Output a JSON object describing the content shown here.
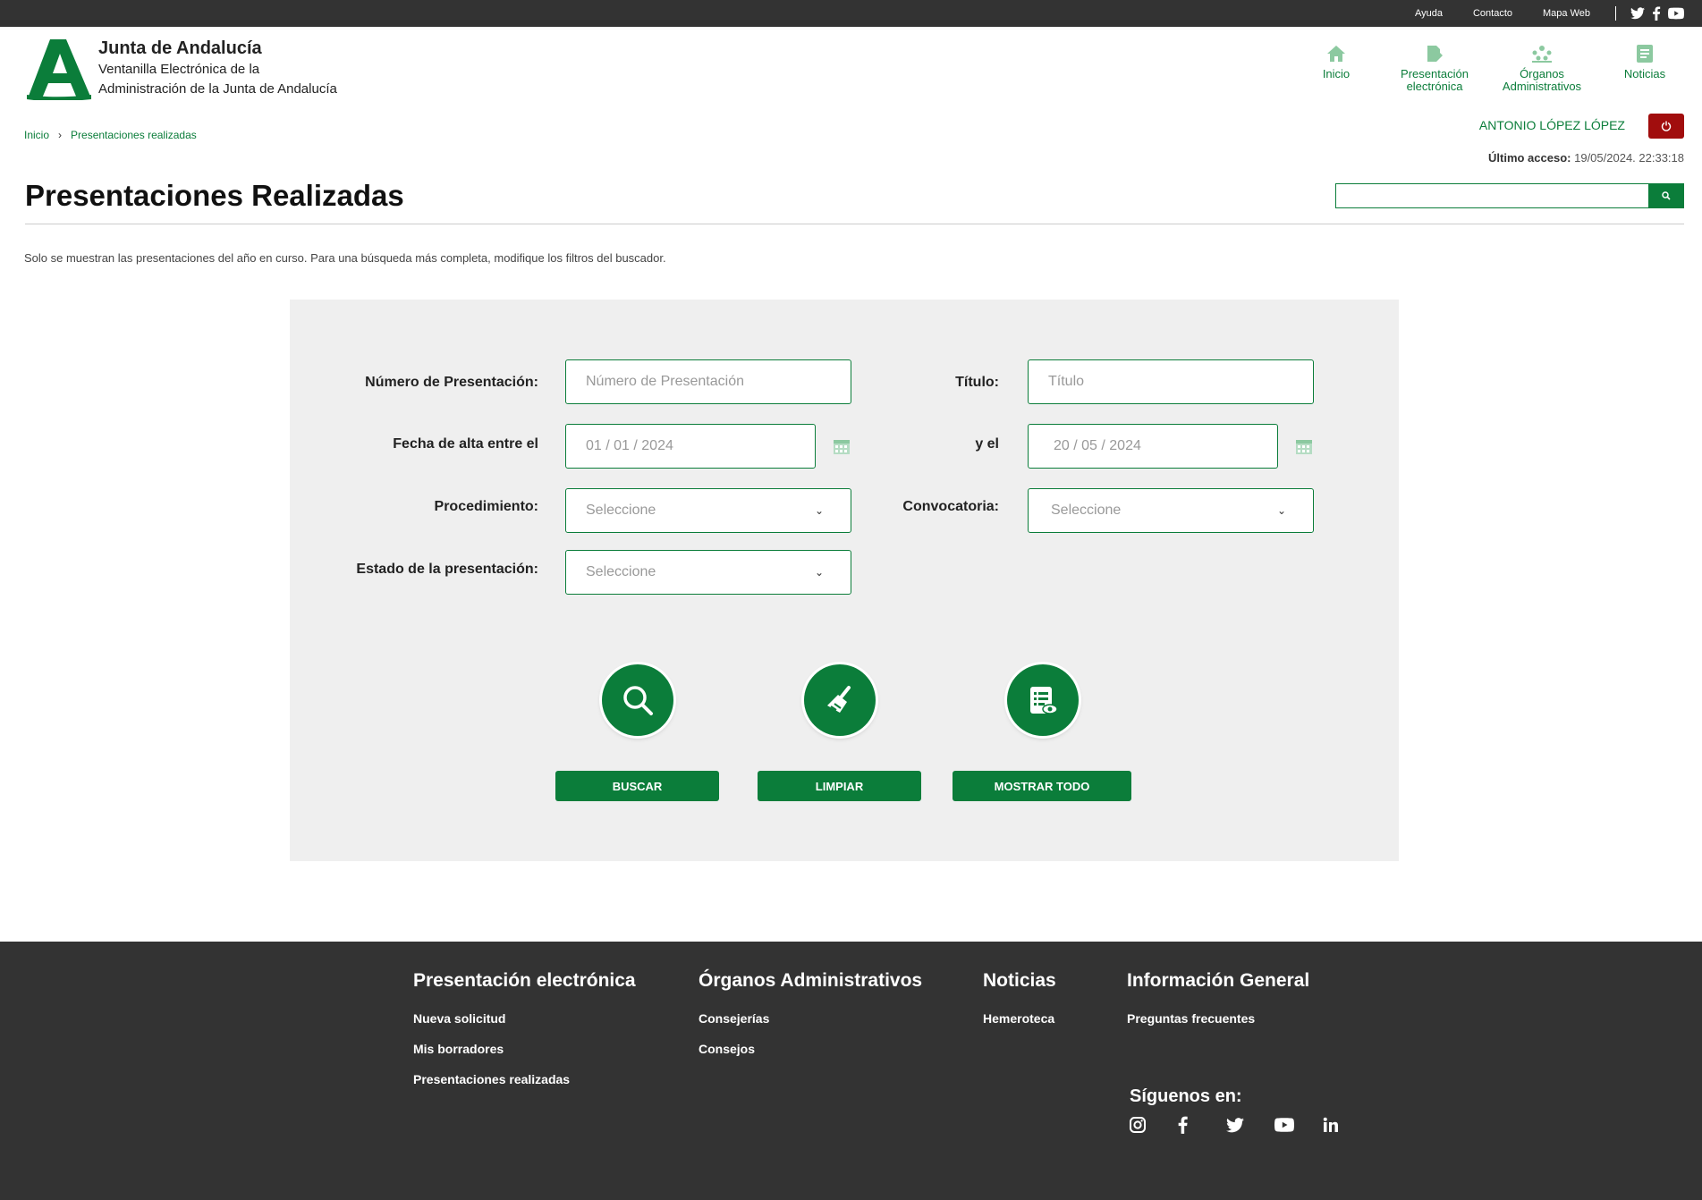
{
  "topbar": {
    "links": [
      "Ayuda",
      "Contacto",
      "Mapa Web"
    ],
    "social_icons": [
      "twitter-icon",
      "facebook-icon",
      "youtube-icon"
    ]
  },
  "header": {
    "brand_title": "Junta de Andalucía",
    "brand_subtitle_1": "Ventanilla Electrónica de la",
    "brand_subtitle_2": "Administración de la Junta de Andalucía",
    "nav": [
      {
        "label_1": "Inicio",
        "label_2": "",
        "icon": "home-icon"
      },
      {
        "label_1": "Presentación",
        "label_2": "electrónica",
        "icon": "document-edit-icon"
      },
      {
        "label_1": "Órganos",
        "label_2": "Administrativos",
        "icon": "organization-icon"
      },
      {
        "label_1": "Noticias",
        "label_2": "",
        "icon": "news-icon"
      }
    ]
  },
  "breadcrumb": {
    "home": "Inicio",
    "current": "Presentaciones realizadas"
  },
  "user": {
    "name": "ANTONIO LÓPEZ LÓPEZ",
    "last_access_label": "Último acceso:",
    "last_access_value": "19/05/2024. 22:33:18"
  },
  "page": {
    "title": "Presentaciones Realizadas",
    "notice": "Solo se muestran las presentaciones del año en curso. Para una búsqueda más completa, modifique los filtros del buscador."
  },
  "filters": {
    "numero_label": "Número de Presentación:",
    "numero_placeholder": "Número de Presentación",
    "titulo_label": "Título:",
    "titulo_placeholder": "Título",
    "fecha_label": "Fecha de alta entre el",
    "fecha_desde": "01 / 01 / 2024",
    "y_el_label": "y el",
    "fecha_hasta": "20 / 05 / 2024",
    "procedimiento_label": "Procedimiento:",
    "procedimiento_value": "Seleccione",
    "convocatoria_label": "Convocatoria:",
    "convocatoria_value": "Seleccione",
    "estado_label": "Estado de la presentación:",
    "estado_value": "Seleccione"
  },
  "actions": {
    "buscar": "BUSCAR",
    "limpiar": "LIMPIAR",
    "mostrar_todo": "MOSTRAR TODO"
  },
  "footer": {
    "columns": [
      {
        "title": "Presentación electrónica",
        "links": [
          "Nueva solicitud",
          "Mis borradores",
          "Presentaciones realizadas"
        ]
      },
      {
        "title": "Órganos Administrativos",
        "links": [
          "Consejerías",
          "Consejos"
        ]
      },
      {
        "title": "Noticias",
        "links": [
          "Hemeroteca"
        ]
      },
      {
        "title": "Información General",
        "links": [
          "Preguntas frecuentes"
        ]
      }
    ],
    "follow_title": "Síguenos en:"
  },
  "colors": {
    "brand_green": "#0b7d3a",
    "dark": "#333333",
    "logout_red": "#a10d0d",
    "panel_bg": "#efefef"
  }
}
